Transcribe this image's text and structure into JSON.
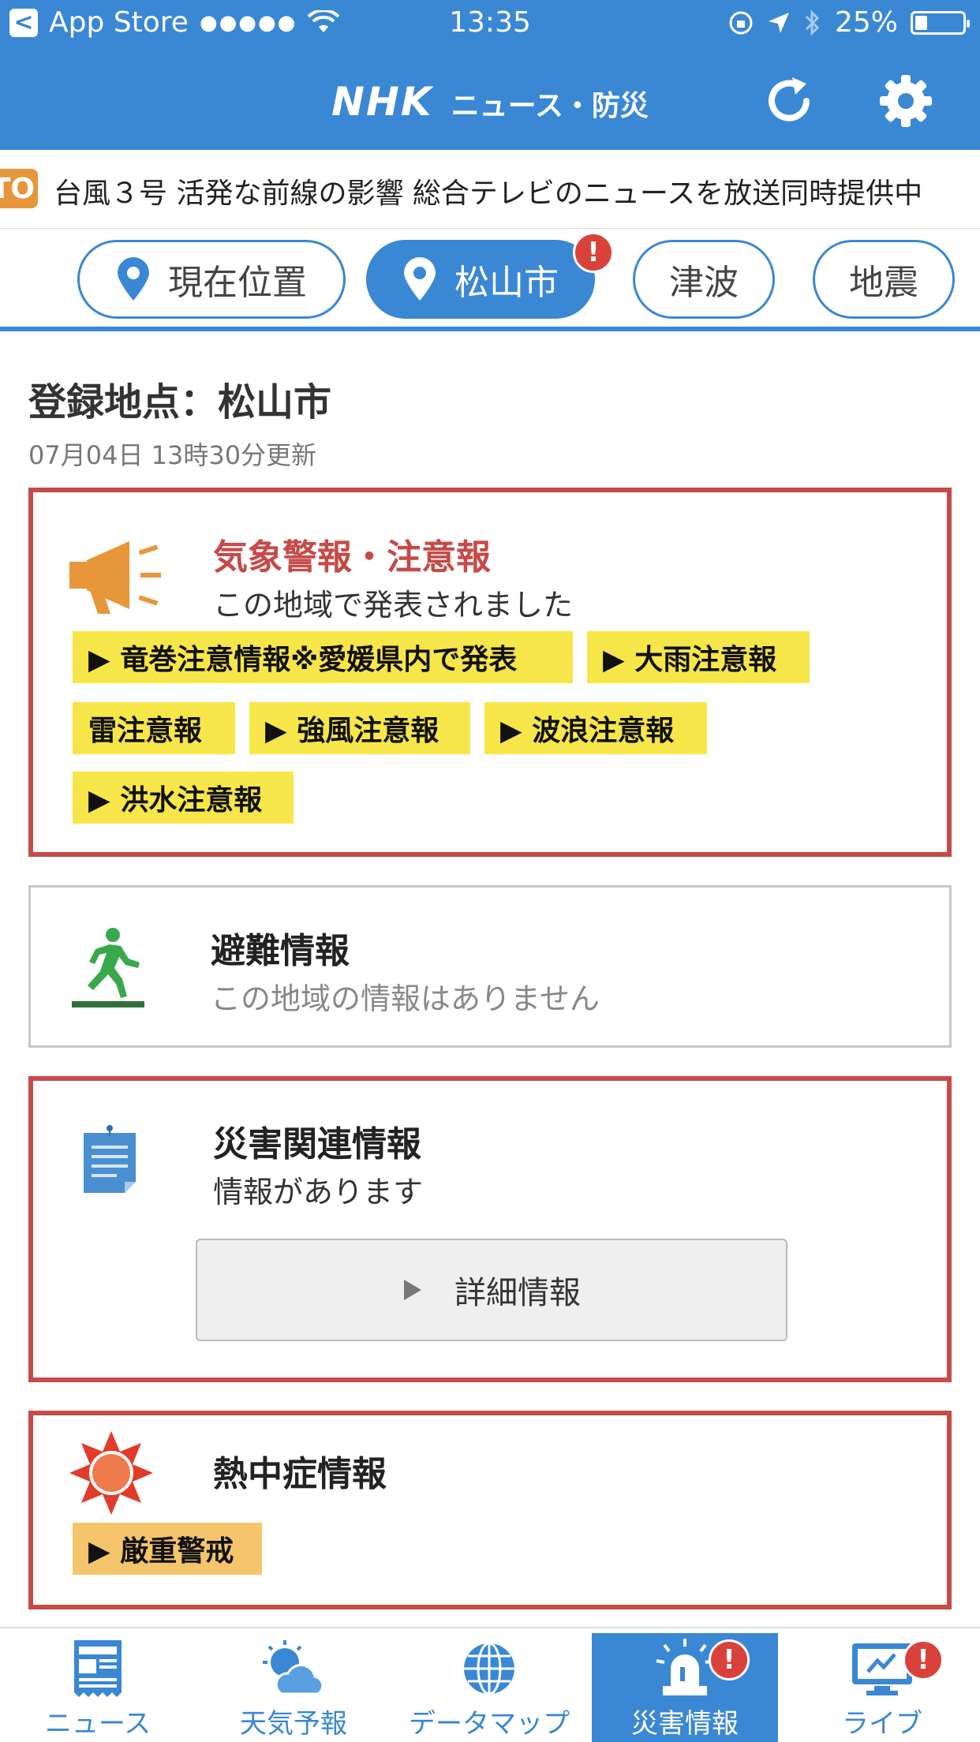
{
  "status_bar": {
    "back_label": "App Store",
    "signal": "●●●●●",
    "time": "13:35",
    "battery_text": "25%",
    "battery_level": 0.25
  },
  "header": {
    "brand": "NHK",
    "subtitle": "ニュース・防災",
    "refresh_icon": "refresh-icon",
    "settings_icon": "gear-icon"
  },
  "ticker": {
    "badge": "TO",
    "text": "台風３号 活発な前線の影響  総合テレビのニュースを放送同時提供中"
  },
  "tabs": [
    {
      "label": "現在位置",
      "icon": "location-pin-icon",
      "active": false
    },
    {
      "label": "松山市",
      "icon": "location-pin-icon",
      "active": true,
      "alert": "!"
    },
    {
      "label": "津波",
      "active": false
    },
    {
      "label": "地震",
      "active": false
    }
  ],
  "location": {
    "title": "登録地点：松山市",
    "updated": "07月04日 13時30分更新"
  },
  "weather_warning": {
    "title": "気象警報・注意報",
    "subtitle": "この地域で発表されました",
    "tags": [
      "▶ 竜巻注意情報※愛媛県内で発表",
      "▶ 大雨注意報",
      "雷注意報",
      "▶ 強風注意報",
      "▶ 波浪注意報",
      "▶ 洪水注意報"
    ]
  },
  "evacuation": {
    "title": "避難情報",
    "subtitle": "この地域の情報はありません"
  },
  "disaster": {
    "title": "災害関連情報",
    "subtitle": "情報があります",
    "button": "詳細情報"
  },
  "heatstroke": {
    "title": "熱中症情報",
    "tag": "▶ 厳重警戒"
  },
  "bottom_nav": [
    {
      "label": "ニュース",
      "icon": "newspaper-icon"
    },
    {
      "label": "天気予報",
      "icon": "weather-icon"
    },
    {
      "label": "データマップ",
      "icon": "globe-icon"
    },
    {
      "label": "災害情報",
      "icon": "siren-icon",
      "active": true,
      "alert": "!"
    },
    {
      "label": "ライブ",
      "icon": "tv-icon",
      "alert": "!"
    }
  ],
  "colors": {
    "primary": "#3a87d4",
    "alert_border": "#c64a4a",
    "tag_yellow": "#f7e64a",
    "tag_orange": "#f4c56a",
    "badge_red": "#d9413b"
  }
}
